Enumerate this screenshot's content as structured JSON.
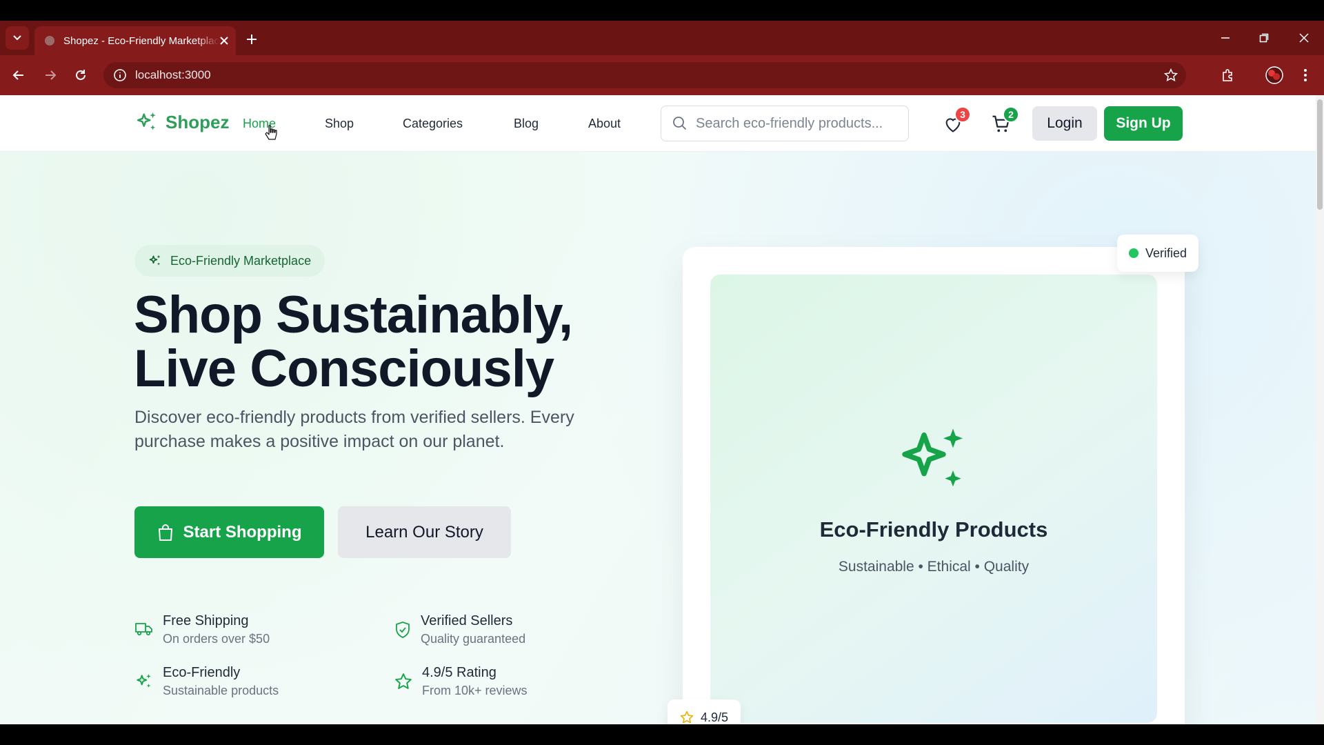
{
  "browser": {
    "tab_title": "Shopez - Eco-Friendly Marketplace",
    "url": "localhost:3000"
  },
  "nav": {
    "brand": "Shopez",
    "links": [
      "Home",
      "Shop",
      "Categories",
      "Blog",
      "About"
    ],
    "active_link": "Home",
    "search_placeholder": "Search eco-friendly products...",
    "wishlist_count": "3",
    "cart_count": "2",
    "login_label": "Login",
    "signup_label": "Sign Up"
  },
  "hero": {
    "pill": "Eco-Friendly Marketplace",
    "headline_line1": "Shop Sustainably,",
    "headline_line2": "Live Consciously",
    "subtitle": "Discover eco-friendly products from verified sellers. Every purchase makes a positive impact on our planet.",
    "primary_cta": "Start Shopping",
    "secondary_cta": "Learn Our Story",
    "features": [
      {
        "title": "Free Shipping",
        "subtitle": "On orders over $50",
        "icon": "truck-icon"
      },
      {
        "title": "Verified Sellers",
        "subtitle": "Quality guaranteed",
        "icon": "shield-check-icon"
      },
      {
        "title": "Eco-Friendly",
        "subtitle": "Sustainable products",
        "icon": "sparkles-icon"
      },
      {
        "title": "4.9/5 Rating",
        "subtitle": "From 10k+ reviews",
        "icon": "star-icon"
      }
    ]
  },
  "card": {
    "title": "Eco-Friendly Products",
    "subtitle": "Sustainable • Ethical • Quality",
    "verified_label": "Verified",
    "rating_label": "4.9/5"
  },
  "colors": {
    "brand_green": "#16a34a",
    "browser_frame": "#861b1b",
    "badge_red": "#ef4444"
  }
}
